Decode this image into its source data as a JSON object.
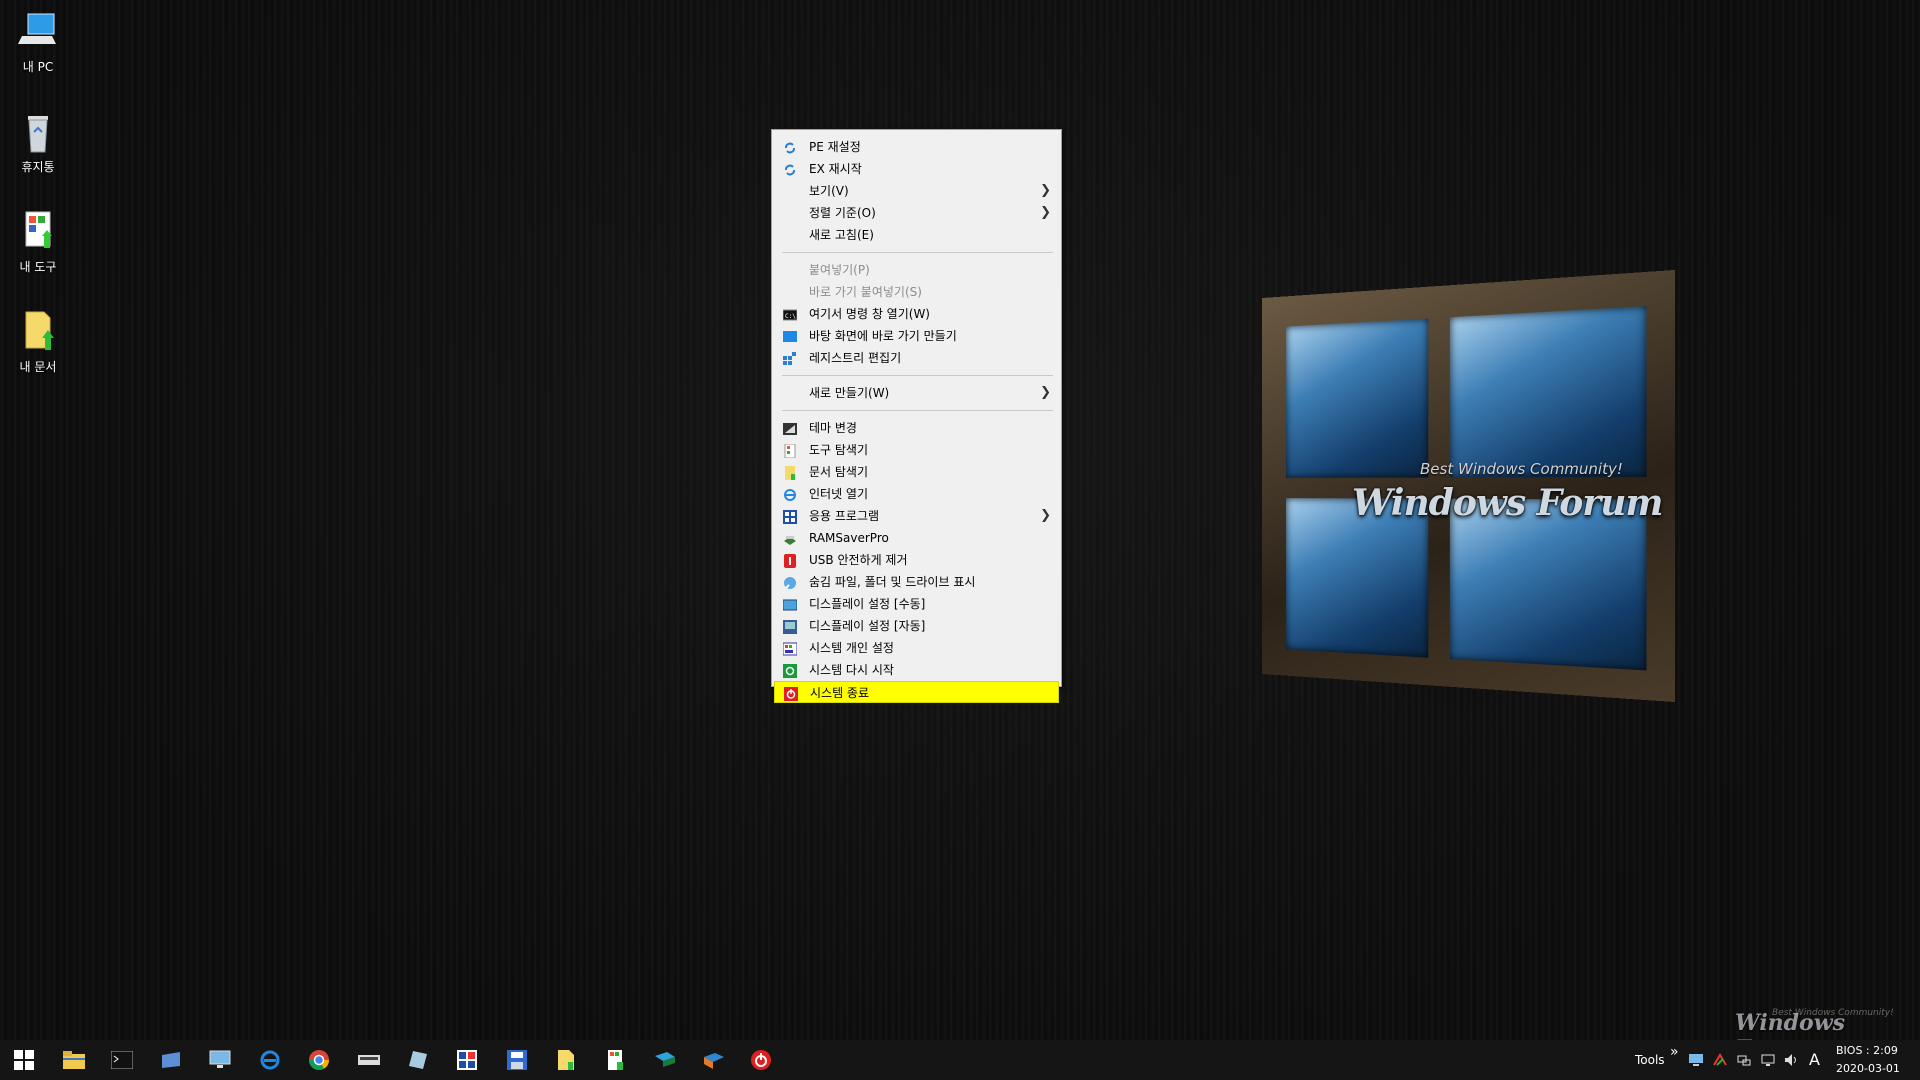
{
  "desktop": {
    "icons": [
      {
        "label": "내 PC",
        "icon": "pc-icon"
      },
      {
        "label": "휴지통",
        "icon": "recycle-bin-icon"
      },
      {
        "label": "내 도구",
        "icon": "tools-folder-icon"
      },
      {
        "label": "내 문서",
        "icon": "documents-folder-icon"
      }
    ]
  },
  "wallpaper": {
    "title": "Windows Forum",
    "subtitle": "Best Windows Community!"
  },
  "watermark": {
    "title": "Windows Forum",
    "subtitle": "Best Windows Community!"
  },
  "context_menu": {
    "items": [
      {
        "label": "PE 재설정",
        "icon": "refresh-icon"
      },
      {
        "label": "EX 재시작",
        "icon": "refresh-icon"
      },
      {
        "label": "보기(V)",
        "submenu": true
      },
      {
        "label": "정렬 기준(O)",
        "submenu": true
      },
      {
        "label": "새로 고침(E)"
      },
      {
        "label": "붙여넣기(P)",
        "disabled": true
      },
      {
        "label": "바로 가기 붙여넣기(S)",
        "disabled": true
      },
      {
        "label": "여기서 명령 창 열기(W)",
        "icon": "cmd-icon"
      },
      {
        "label": "바탕 화면에 바로 가기 만들기",
        "icon": "monitor-icon"
      },
      {
        "label": "레지스트리 편집기",
        "icon": "registry-icon"
      },
      {
        "label": "새로 만들기(W)",
        "submenu": true
      },
      {
        "label": "테마 변경",
        "icon": "theme-icon"
      },
      {
        "label": "도구 탐색기",
        "icon": "tools-icon"
      },
      {
        "label": "문서 탐색기",
        "icon": "document-icon"
      },
      {
        "label": "인터넷 열기",
        "icon": "ie-icon"
      },
      {
        "label": "응용 프로그램",
        "icon": "apps-icon",
        "submenu": true
      },
      {
        "label": "RAMSaverPro",
        "icon": "ram-icon"
      },
      {
        "label": "USB 안전하게 제거",
        "icon": "usb-icon"
      },
      {
        "label": "숨김 파일, 폴더 및 드라이브 표시",
        "icon": "hidden-files-icon"
      },
      {
        "label": "디스플레이 설정 [수동]",
        "icon": "display-icon"
      },
      {
        "label": "디스플레이 설정 [자동]",
        "icon": "display-auto-icon"
      },
      {
        "label": "시스템 개인 설정",
        "icon": "personalize-icon"
      },
      {
        "label": "시스템 다시 시작",
        "icon": "restart-icon"
      },
      {
        "label": "시스템 종료",
        "icon": "shutdown-icon",
        "selected": true
      }
    ]
  },
  "taskbar": {
    "tools_label": "Tools",
    "overflow": "»",
    "ime": "A",
    "clock_time": "BIOS : 2:09",
    "clock_date": "2020-03-01"
  },
  "colors": {
    "highlight": "#ffff00",
    "menu_bg": "#f0f0f0",
    "taskbar_bg": "#151515"
  }
}
